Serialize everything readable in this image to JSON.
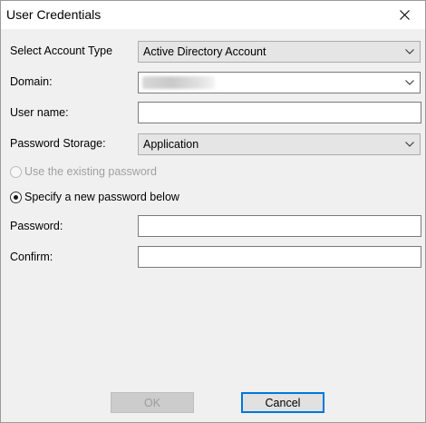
{
  "window": {
    "title": "User Credentials",
    "close_glyph": "close-icon"
  },
  "form": {
    "account_type": {
      "label": "Select Account Type",
      "value": "Active Directory Account",
      "options": [
        "Active Directory Account"
      ]
    },
    "domain": {
      "label": "Domain:",
      "value": ""
    },
    "username": {
      "label": "User name:",
      "value": ""
    },
    "password_storage": {
      "label": "Password Storage:",
      "value": "Application"
    },
    "radio_existing": {
      "label": "Use the existing password",
      "checked": false,
      "enabled": false
    },
    "radio_new": {
      "label": "Specify a new password below",
      "checked": true,
      "enabled": true
    },
    "password": {
      "label": "Password:",
      "value": ""
    },
    "confirm": {
      "label": "Confirm:",
      "value": ""
    }
  },
  "buttons": {
    "ok_label": "OK",
    "cancel_label": "Cancel"
  },
  "colors": {
    "focus_border": "#0078d7",
    "dialog_bg": "#f0f0f0",
    "disabled_text": "#a0a0a0"
  }
}
